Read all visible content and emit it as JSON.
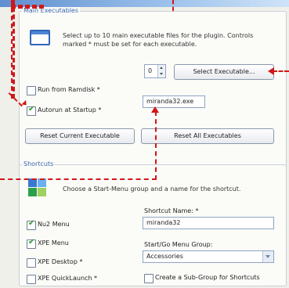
{
  "main_group": {
    "title": "Main Executables",
    "description": "Select up to 10 main executable files for the plugin. Controls marked * must be set for each executable.",
    "spinner_value": "0",
    "select_executable_label": "Select Executable...",
    "run_from_ramdisk_label": "Run from Ramdisk *",
    "run_from_ramdisk_checked": false,
    "autorun_label": "Autorun at Startup *",
    "autorun_checked": true,
    "executable_value": "miranda32.exe",
    "reset_current_label": "Reset Current Executable",
    "reset_all_label": "Reset All Executables"
  },
  "shortcuts_group": {
    "title": "Shortcuts",
    "description": "Choose a Start-Menu group and a name for the shortcut.",
    "shortcut_name_label": "Shortcut Name: *",
    "shortcut_name_value": "miranda32",
    "start_group_label": "Start/Go Menu Group:",
    "start_group_value": "Accessories",
    "items": [
      {
        "label": "Nu2 Menu",
        "checked": true
      },
      {
        "label": "XPE Menu",
        "checked": true
      },
      {
        "label": "XPE Desktop *",
        "checked": false
      },
      {
        "label": "XPE QuickLaunch *",
        "checked": false
      }
    ],
    "subgroup_label": "Create a Sub-Group for Shortcuts",
    "subgroup_checked": false
  },
  "colors": {
    "annotation_red": "#d01818",
    "group_title_blue": "#3a67b0"
  }
}
